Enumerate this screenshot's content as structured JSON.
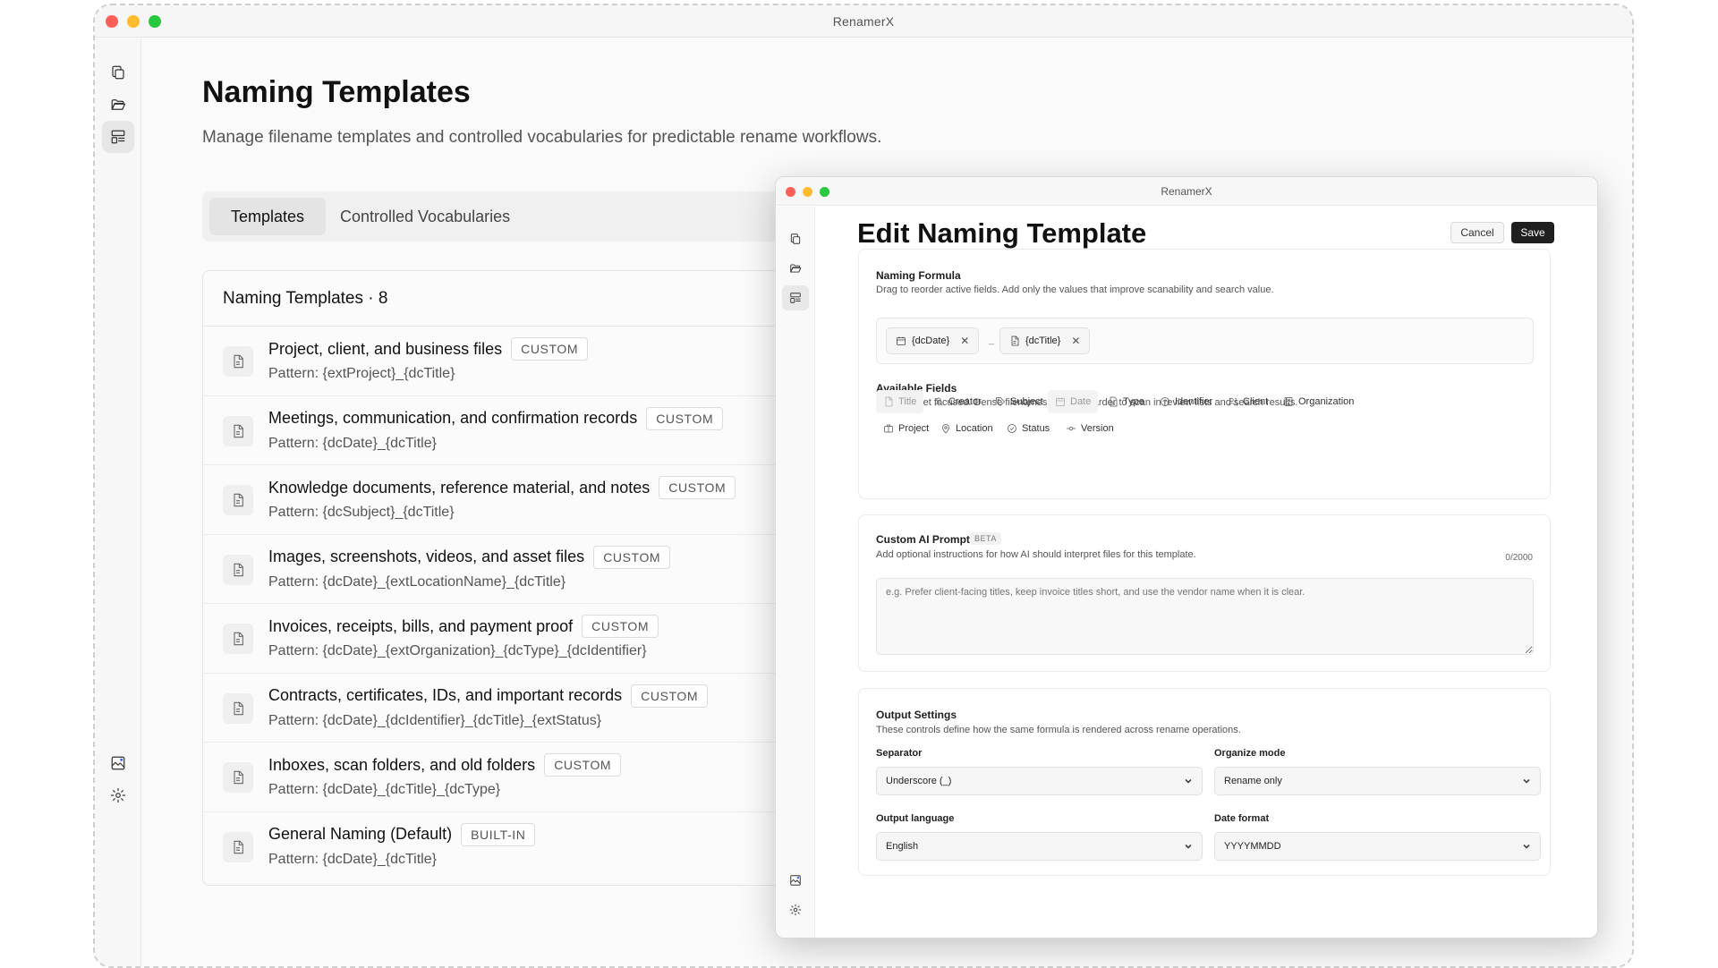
{
  "app": {
    "title": "RenamerX"
  },
  "page": {
    "title": "Naming Templates",
    "subtitle": "Manage filename templates and controlled vocabularies for predictable rename workflows."
  },
  "sidebar": {
    "icons": [
      "copy-icon",
      "folder-open-icon",
      "layout-templates-icon",
      "image-ai-icon",
      "gear-icon"
    ],
    "active": "layout-templates-icon"
  },
  "tabs": [
    {
      "label": "Templates",
      "active": true
    },
    {
      "label": "Controlled Vocabularies",
      "active": false
    }
  ],
  "templates": {
    "header": "Naming Templates · 8",
    "items": [
      {
        "name": "Project, client, and business files",
        "badge": "CUSTOM",
        "pattern": "Pattern: {extProject}_{dcTitle}"
      },
      {
        "name": "Meetings, communication, and confirmation records",
        "badge": "CUSTOM",
        "pattern": "Pattern: {dcDate}_{dcTitle}"
      },
      {
        "name": "Knowledge documents, reference material, and notes",
        "badge": "CUSTOM",
        "pattern": "Pattern: {dcSubject}_{dcTitle}"
      },
      {
        "name": "Images, screenshots, videos, and asset files",
        "badge": "CUSTOM",
        "pattern": "Pattern: {dcDate}_{extLocationName}_{dcTitle}"
      },
      {
        "name": "Invoices, receipts, bills, and payment proof",
        "badge": "CUSTOM",
        "pattern": "Pattern: {dcDate}_{extOrganization}_{dcType}_{dcIdentifier}"
      },
      {
        "name": "Contracts, certificates, IDs, and important records",
        "badge": "CUSTOM",
        "pattern": "Pattern: {dcDate}_{dcIdentifier}_{dcTitle}_{extStatus}"
      },
      {
        "name": "Inboxes, scan folders, and old folders",
        "badge": "CUSTOM",
        "pattern": "Pattern: {dcDate}_{dcTitle}_{dcType}"
      },
      {
        "name": "General Naming (Default)",
        "badge": "BUILT-IN",
        "pattern": "Pattern: {dcDate}_{dcTitle}"
      }
    ]
  },
  "editor": {
    "window_title": "RenamerX",
    "heading": "Edit Naming Template",
    "cancel_label": "Cancel",
    "save_label": "Save",
    "formula": {
      "title": "Naming Formula",
      "description": "Drag to reorder active fields. Add only the values that improve scanability and search value.",
      "active_fields": [
        {
          "label": "{dcDate}",
          "icon": "calendar-icon"
        },
        {
          "label": "{dcTitle}",
          "icon": "document-icon"
        }
      ],
      "separator_mark": "_"
    },
    "available": {
      "title": "Available Fields",
      "description": "Keep the set focused. Dense filenames become harder to scan in review lists and search results.",
      "fields": [
        {
          "label": "Title",
          "icon": "document-icon",
          "used": true
        },
        {
          "label": "Creator",
          "icon": "person-icon",
          "used": false
        },
        {
          "label": "Subject",
          "icon": "tag-icon",
          "used": false
        },
        {
          "label": "Date",
          "icon": "calendar-icon",
          "used": true
        },
        {
          "label": "Type",
          "icon": "file-type-icon",
          "used": false
        },
        {
          "label": "Identifier",
          "icon": "fingerprint-icon",
          "used": false
        },
        {
          "label": "Client",
          "icon": "users-icon",
          "used": false
        },
        {
          "label": "Organization",
          "icon": "building-icon",
          "used": false
        },
        {
          "label": "Project",
          "icon": "briefcase-icon",
          "used": false
        },
        {
          "label": "Location",
          "icon": "map-pin-icon",
          "used": false
        },
        {
          "label": "Status",
          "icon": "check-circle-icon",
          "used": false
        },
        {
          "label": "Version",
          "icon": "commit-icon",
          "used": false
        }
      ]
    },
    "prompt": {
      "title": "Custom AI Prompt",
      "badge": "BETA",
      "description": "Add optional instructions for how AI should interpret files for this template.",
      "counter": "0/2000",
      "placeholder": "e.g. Prefer client-facing titles, keep invoice titles short, and use the vendor name when it is clear.",
      "value": ""
    },
    "output": {
      "title": "Output Settings",
      "description": "These controls define how the same formula is rendered across rename operations.",
      "separator_label": "Separator",
      "separator_value": "Underscore (_)",
      "organize_label": "Organize mode",
      "organize_value": "Rename only",
      "language_label": "Output language",
      "language_value": "English",
      "date_label": "Date format",
      "date_value": "YYYYMMDD"
    }
  }
}
